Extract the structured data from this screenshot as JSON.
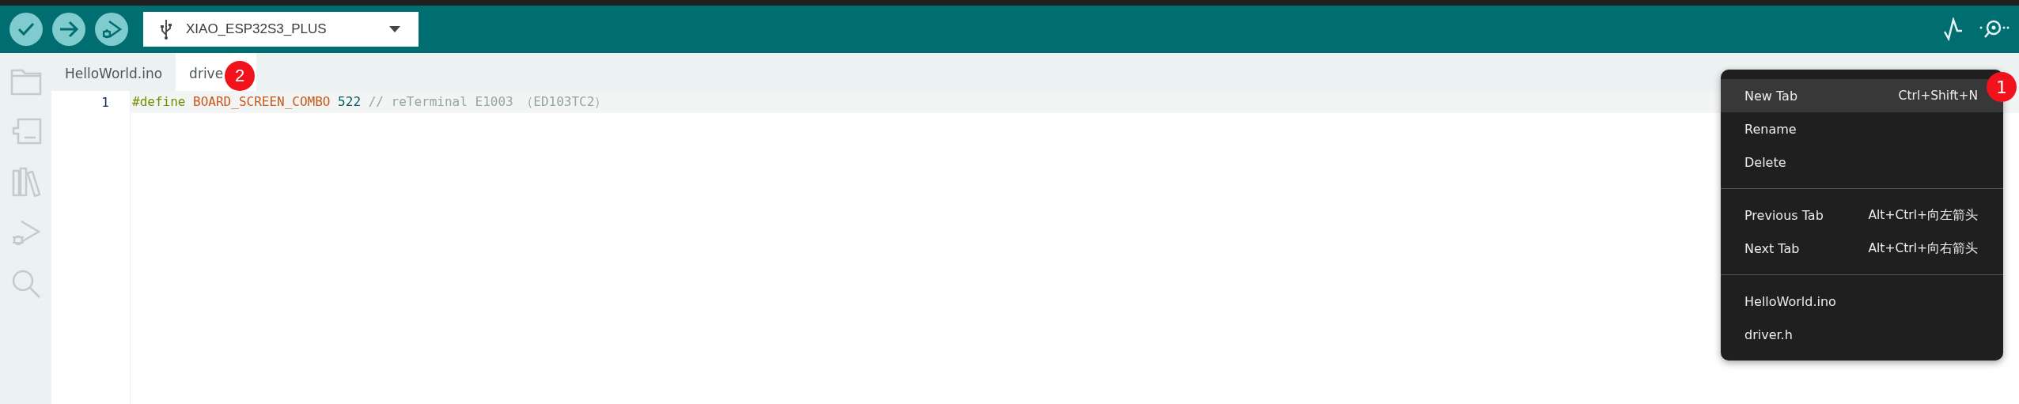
{
  "toolbar": {
    "board": "XIAO_ESP32S3_PLUS"
  },
  "tabs": [
    {
      "label": "HelloWorld.ino",
      "selected": false
    },
    {
      "label": "drive",
      "selected": true,
      "badge": "2"
    }
  ],
  "editor": {
    "lines": [
      {
        "number": "1",
        "highlighted": true,
        "tokens": [
          {
            "kind": "directive",
            "text": "#define"
          },
          {
            "kind": "macro",
            "text": "BOARD_SCREEN_COMBO"
          },
          {
            "kind": "number",
            "text": "522"
          },
          {
            "kind": "comment",
            "text": "// reTerminal E1003 （ED103TC2）"
          }
        ]
      }
    ]
  },
  "context_menu": {
    "badge": "1",
    "groups": [
      [
        {
          "label": "New Tab",
          "shortcut": "Ctrl+Shift+N",
          "selected": true
        },
        {
          "label": "Rename",
          "selected": false
        },
        {
          "label": "Delete",
          "selected": false
        }
      ],
      [
        {
          "label": "Previous Tab",
          "shortcut": "Alt+Ctrl+向左箭头",
          "selected": false
        },
        {
          "label": "Next Tab",
          "shortcut": "Alt+Ctrl+向右箭头",
          "selected": false
        }
      ],
      [
        {
          "label": "HelloWorld.ino",
          "selected": false
        },
        {
          "label": "driver.h",
          "selected": false
        }
      ]
    ]
  }
}
